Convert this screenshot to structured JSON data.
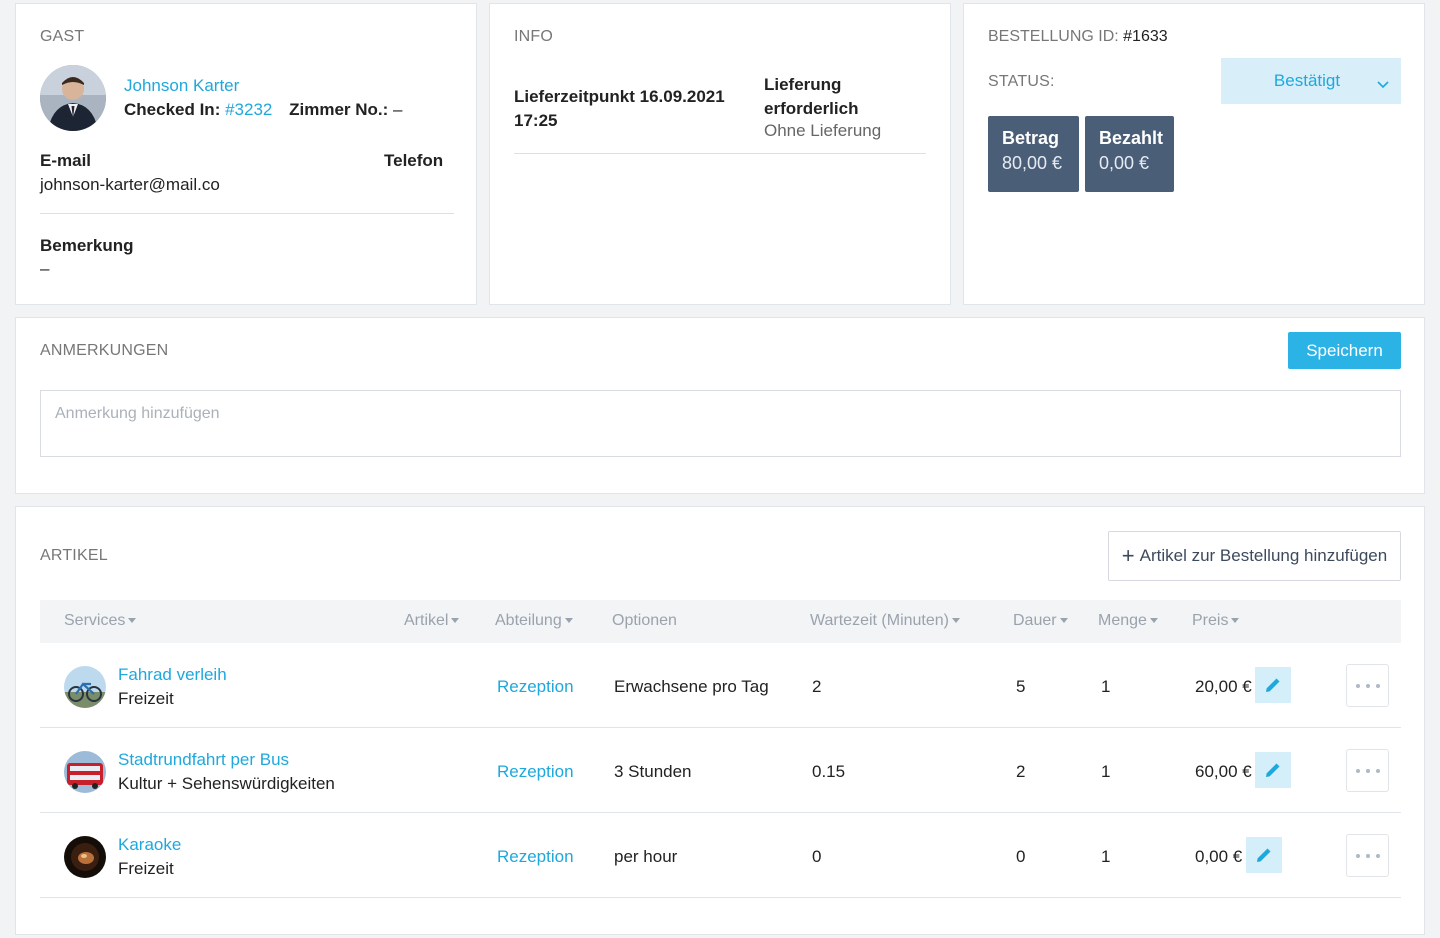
{
  "guest": {
    "section_title": "GAST",
    "name": "Johnson Karter",
    "checked_in_label": "Checked In:",
    "checked_in_value": "#3232",
    "room_label": "Zimmer No.:",
    "room_value": "–",
    "email_label": "E-mail",
    "email_value": "johnson-karter@mail.co",
    "phone_label": "Telefon",
    "remark_label": "Bemerkung",
    "remark_value": "–"
  },
  "info": {
    "section_title": "INFO",
    "delivery_time": "Lieferzeitpunkt 16.09.2021 17:25",
    "delivery_required": "Lieferung erforderlich",
    "delivery_option": "Ohne Lieferung"
  },
  "order": {
    "id_label": "BESTELLUNG ID:",
    "id_value": "#1633",
    "status_label": "STATUS:",
    "status_value": "Bestätigt",
    "amount_label": "Betrag",
    "amount_value": "80,00 €",
    "paid_label": "Bezahlt",
    "paid_value": "0,00 €"
  },
  "notes": {
    "section_title": "ANMERKUNGEN",
    "save_label": "Speichern",
    "placeholder": "Anmerkung hinzufügen"
  },
  "items": {
    "section_title": "ARTIKEL",
    "add_label": "Artikel zur Bestellung hinzufügen",
    "columns": {
      "services": "Services",
      "artikel": "Artikel",
      "abteilung": "Abteilung",
      "optionen": "Optionen",
      "wartezeit": "Wartezeit (Minuten)",
      "dauer": "Dauer",
      "menge": "Menge",
      "preis": "Preis"
    },
    "rows": [
      {
        "name": "Fahrad verleih",
        "category": "Freizeit",
        "department": "Rezeption",
        "option": "Erwachsene pro Tag",
        "wait": "2",
        "duration": "5",
        "quantity": "1",
        "price": "20,00 €"
      },
      {
        "name": "Stadtrundfahrt per Bus",
        "category": "Kultur + Sehenswürdigkeiten",
        "department": "Rezeption",
        "option": "3 Stunden",
        "wait": "0.15",
        "duration": "2",
        "quantity": "1",
        "price": "60,00 €"
      },
      {
        "name": "Karaoke",
        "category": "Freizeit",
        "department": "Rezeption",
        "option": "per hour",
        "wait": "0",
        "duration": "0",
        "quantity": "1",
        "price": "0,00 €"
      }
    ]
  },
  "colors": {
    "accent": "#1fa8dc",
    "primary_button": "#2bb3e6",
    "stat_box": "#4b5e78",
    "status_bg": "#d8effa"
  }
}
